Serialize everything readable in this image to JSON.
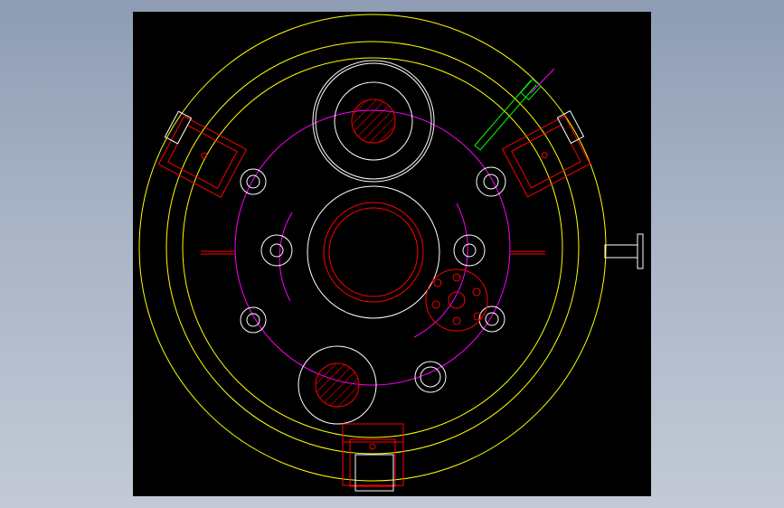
{
  "canvas": {
    "background": "#000000",
    "desktop_gradient_top": "#8e9db4",
    "desktop_gradient_bottom": "#c3cad6"
  },
  "layer_colors": {
    "outer_rings": "#ffff00",
    "bolt_circle": "#ff00ff",
    "components": "#ffffff",
    "flanges_and_brackets": "#ff0000",
    "inclined_support": "#00ff00"
  },
  "drawing": {
    "type": "cad-plan-view",
    "shapes": [
      "outer-yellow-rings",
      "magenta-bolt-circle",
      "central-bore",
      "upper-hatched-port",
      "lower-hatched-port",
      "bolt-holes",
      "side-flange-brackets",
      "bottom-bracket",
      "right-nozzle",
      "red-bolt-flange",
      "green-inclined-support"
    ]
  }
}
